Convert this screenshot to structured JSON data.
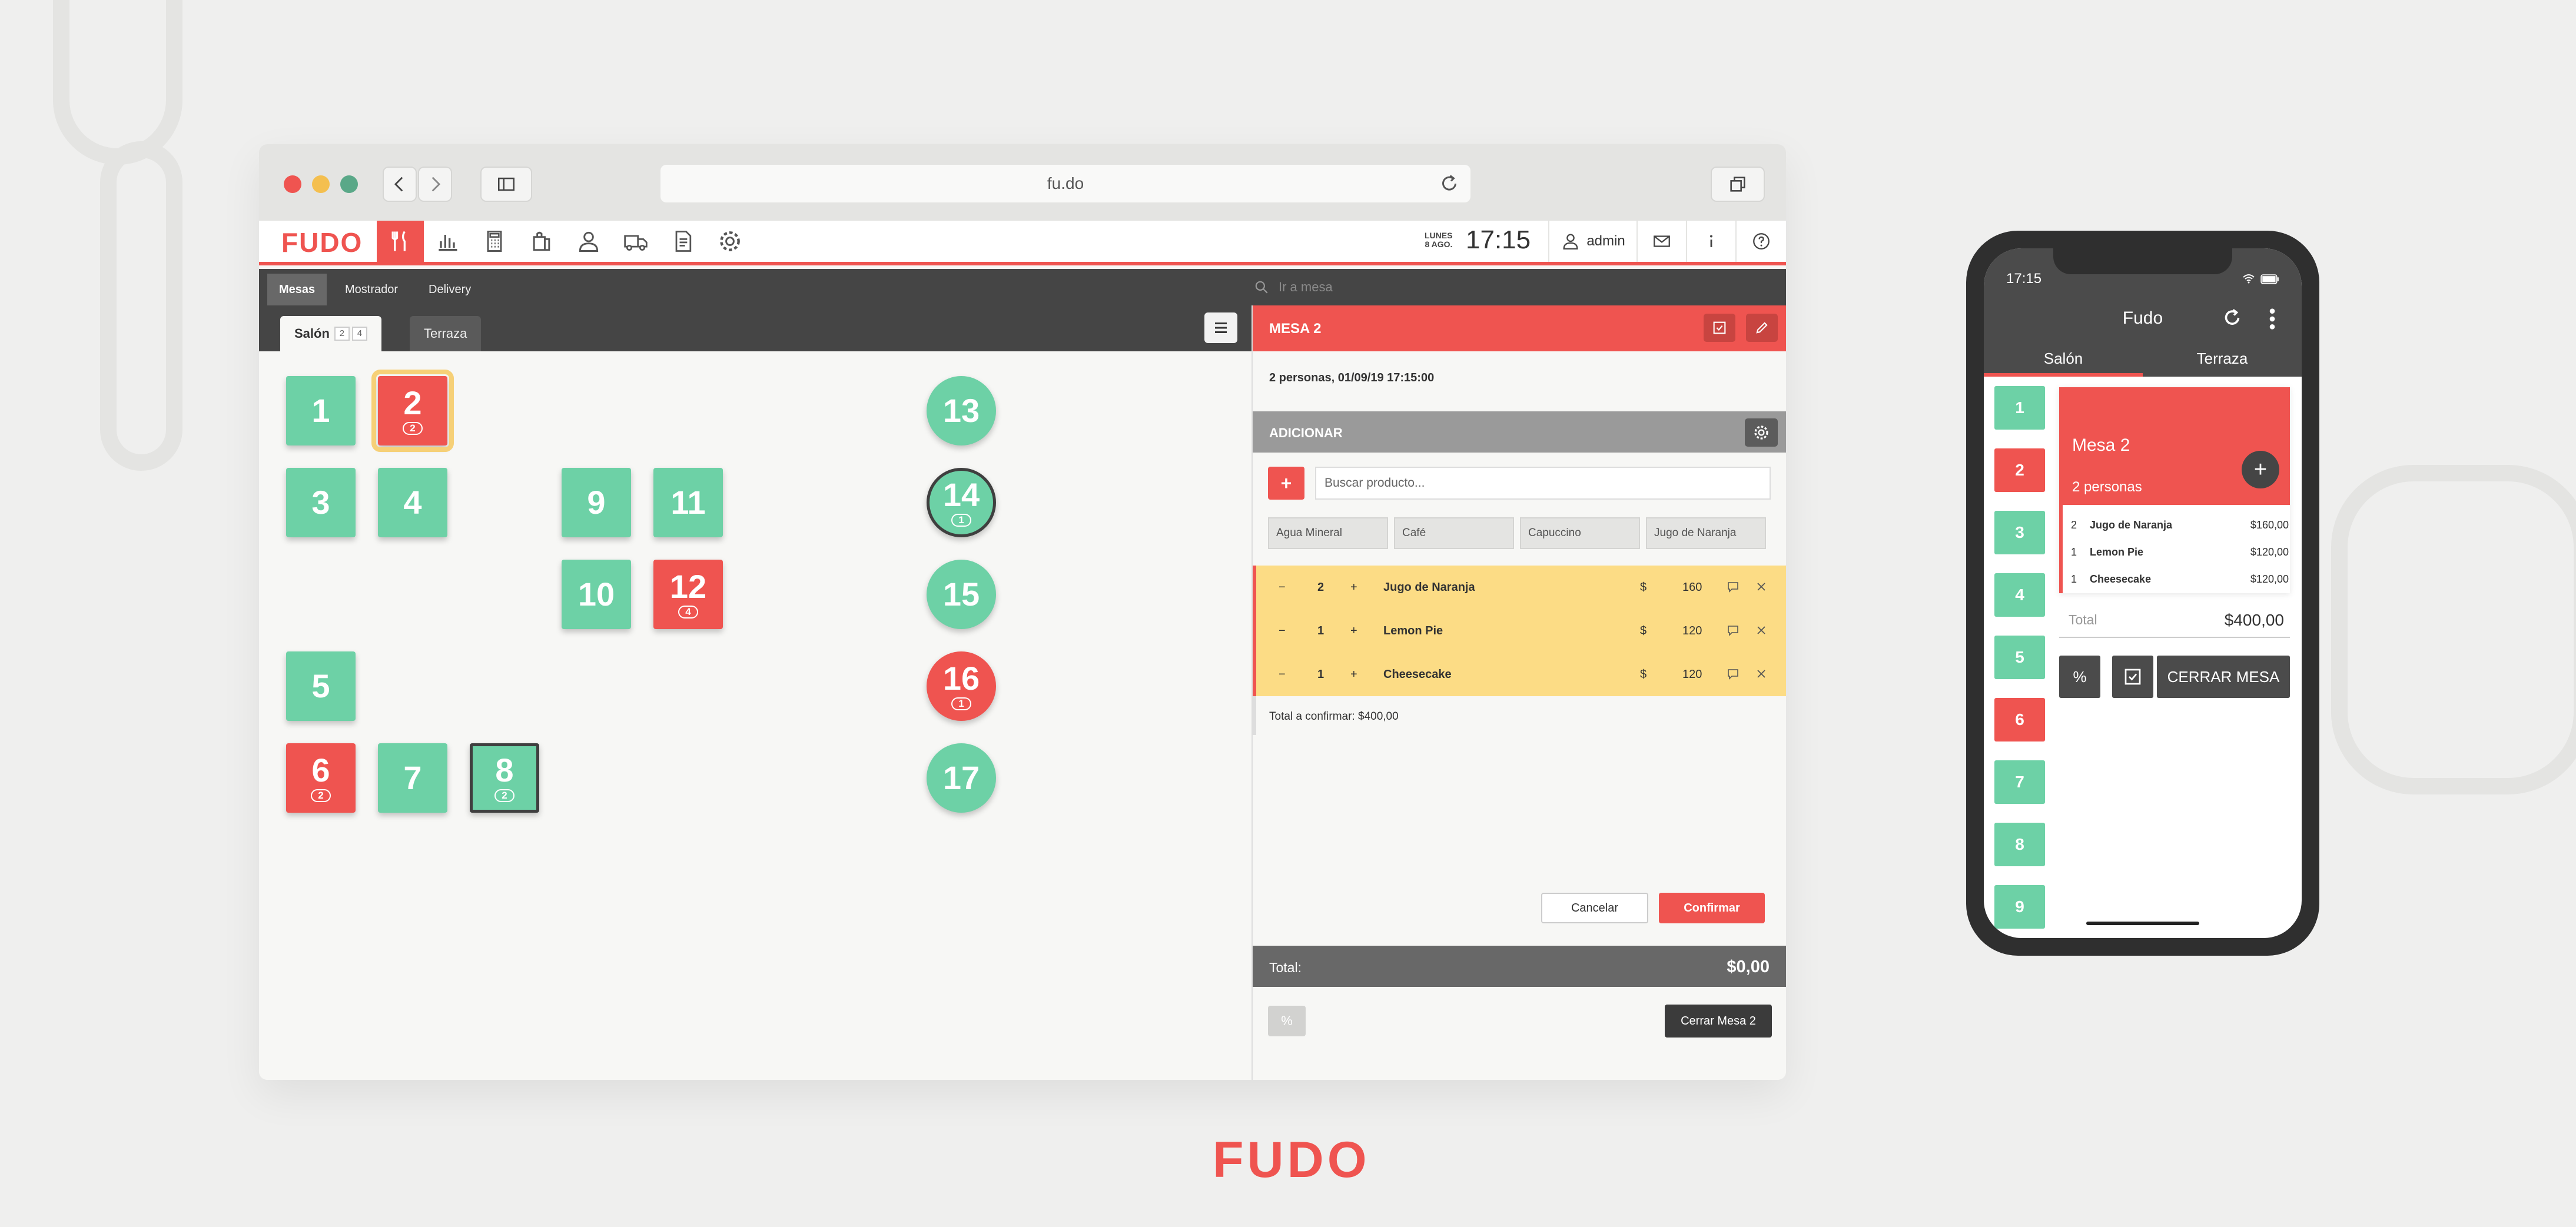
{
  "browser": {
    "url": "fu.do"
  },
  "app": {
    "logo": "FUDO",
    "nav_icons": [
      "utensils-icon",
      "bar-chart-icon",
      "calculator-icon",
      "bag-icon",
      "user-icon",
      "truck-icon",
      "document-icon",
      "gear-icon"
    ],
    "date_line1": "LUNES",
    "date_line2": "8 AGO.",
    "time": "17:15",
    "user": "admin"
  },
  "subtabs": [
    "Mesas",
    "Mostrador",
    "Delivery"
  ],
  "search_placeholder": "Ir a mesa",
  "floors": {
    "salon": {
      "label": "Salón",
      "count_a": "2",
      "count_b": "4"
    },
    "terraza": {
      "label": "Terraza"
    }
  },
  "tables": [
    {
      "n": "1",
      "status": "free"
    },
    {
      "n": "2",
      "status": "busy",
      "badge": "2",
      "selected": true
    },
    {
      "n": "3",
      "status": "free"
    },
    {
      "n": "4",
      "status": "free"
    },
    {
      "n": "9",
      "status": "free"
    },
    {
      "n": "11",
      "status": "free"
    },
    {
      "n": "10",
      "status": "free"
    },
    {
      "n": "12",
      "status": "busy",
      "badge": "4"
    },
    {
      "n": "5",
      "status": "free"
    },
    {
      "n": "6",
      "status": "busy",
      "badge": "2"
    },
    {
      "n": "7",
      "status": "free"
    },
    {
      "n": "8",
      "status": "free",
      "badge": "2",
      "ring": true
    },
    {
      "n": "13",
      "status": "free",
      "shape": "round"
    },
    {
      "n": "14",
      "status": "free",
      "shape": "round",
      "badge": "1",
      "ring": true
    },
    {
      "n": "15",
      "status": "free",
      "shape": "round"
    },
    {
      "n": "16",
      "status": "busy",
      "shape": "round",
      "badge": "1"
    },
    {
      "n": "17",
      "status": "free",
      "shape": "round"
    }
  ],
  "panel": {
    "title": "MESA 2",
    "info": "2 personas, 01/09/19 17:15:00",
    "add_title": "ADICIONAR",
    "add_plus": "+",
    "search_placeholder": "Buscar producto...",
    "quick_products": [
      "Agua Mineral",
      "Café",
      "Capuccino",
      "Jugo de Naranja"
    ],
    "orders": [
      {
        "minus": "−",
        "qty": "2",
        "plus": "+",
        "name": "Jugo de Naranja",
        "currency": "$",
        "price": "160"
      },
      {
        "minus": "−",
        "qty": "1",
        "plus": "+",
        "name": "Lemon Pie",
        "currency": "$",
        "price": "120"
      },
      {
        "minus": "−",
        "qty": "1",
        "plus": "+",
        "name": "Cheesecake",
        "currency": "$",
        "price": "120"
      }
    ],
    "total_confirm": "Total a confirmar: $400,00",
    "cancel": "Cancelar",
    "confirm": "Confirmar",
    "total_label": "Total:",
    "total_value": "$0,00",
    "percent": "%",
    "close": "Cerrar Mesa 2"
  },
  "footer_logo": "FUDO",
  "phone": {
    "time": "17:15",
    "title": "Fudo",
    "tabs": [
      "Salón",
      "Terraza"
    ],
    "tables": [
      {
        "n": "1",
        "status": "free"
      },
      {
        "n": "2",
        "status": "busy"
      },
      {
        "n": "3",
        "status": "free"
      },
      {
        "n": "4",
        "status": "free"
      },
      {
        "n": "5",
        "status": "free"
      },
      {
        "n": "6",
        "status": "busy"
      },
      {
        "n": "7",
        "status": "free"
      },
      {
        "n": "8",
        "status": "free"
      },
      {
        "n": "9",
        "status": "free"
      }
    ],
    "card_title": "Mesa 2",
    "card_sub": "2 personas",
    "card_plus": "+",
    "items": [
      {
        "qty": "2",
        "name": "Jugo de Naranja",
        "price": "$160,00"
      },
      {
        "qty": "1",
        "name": "Lemon Pie",
        "price": "$120,00"
      },
      {
        "qty": "1",
        "name": "Cheesecake",
        "price": "$120,00"
      }
    ],
    "total_label": "Total",
    "total_value": "$400,00",
    "percent": "%",
    "close": "CERRAR MESA"
  },
  "colors": {
    "accent": "#ef5450",
    "free": "#6dd1a6",
    "dark": "#454545",
    "pending": "#fcdc85"
  }
}
